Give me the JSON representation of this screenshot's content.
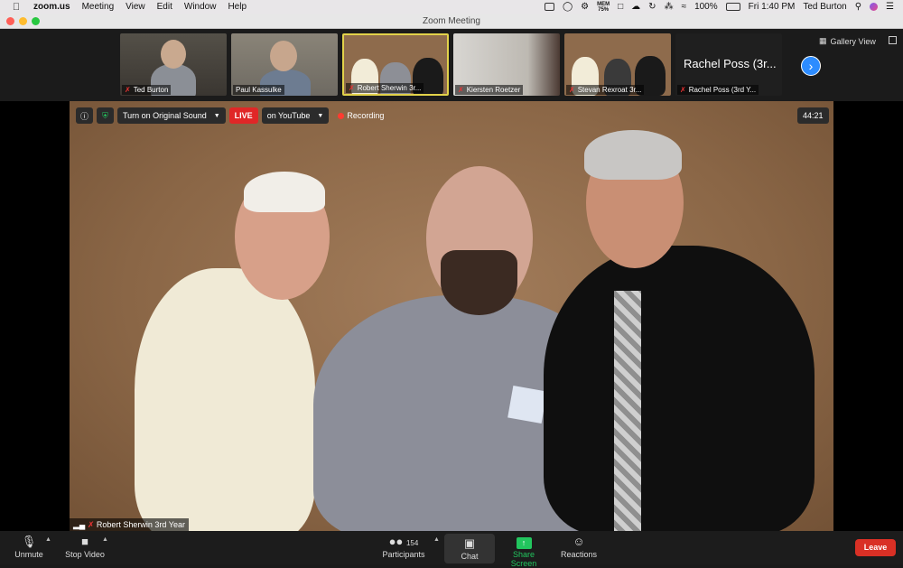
{
  "menubar": {
    "app_name": "zoom.us",
    "menus": [
      "Meeting",
      "View",
      "Edit",
      "Window",
      "Help"
    ],
    "mem_label": "MEM",
    "mem_value": "75%",
    "battery": "100%",
    "clock": "Fri 1:40 PM",
    "user": "Ted Burton"
  },
  "window": {
    "title": "Zoom Meeting"
  },
  "gallery": {
    "participants": [
      {
        "name": "Ted Burton"
      },
      {
        "name": "Paul Kassulke"
      },
      {
        "name": "Robert Sherwin 3r..."
      },
      {
        "name": "Kiersten Roetzer"
      },
      {
        "name": "Stevan Rexroat 3r..."
      },
      {
        "name": "Rachel Poss (3rd Y...",
        "display_text": "Rachel Poss (3r..."
      }
    ],
    "view_label": "Gallery View"
  },
  "main_video": {
    "speaker_name": "Robert Sherwin 3rd Year",
    "original_sound_label": "Turn on Original Sound",
    "live_label": "LIVE",
    "live_platform": "on YouTube",
    "recording_label": "Recording",
    "timer": "44:21"
  },
  "toolbar": {
    "unmute": "Unmute",
    "stop_video": "Stop Video",
    "participants_label": "Participants",
    "participants_count": "154",
    "chat": "Chat",
    "share_screen": "Share Screen",
    "reactions": "Reactions",
    "leave": "Leave"
  },
  "colors": {
    "accent": "#2d8cff",
    "live": "#e02727",
    "leave": "#d93025",
    "share": "#22c55e",
    "active_speaker_border": "#e2d24a"
  }
}
